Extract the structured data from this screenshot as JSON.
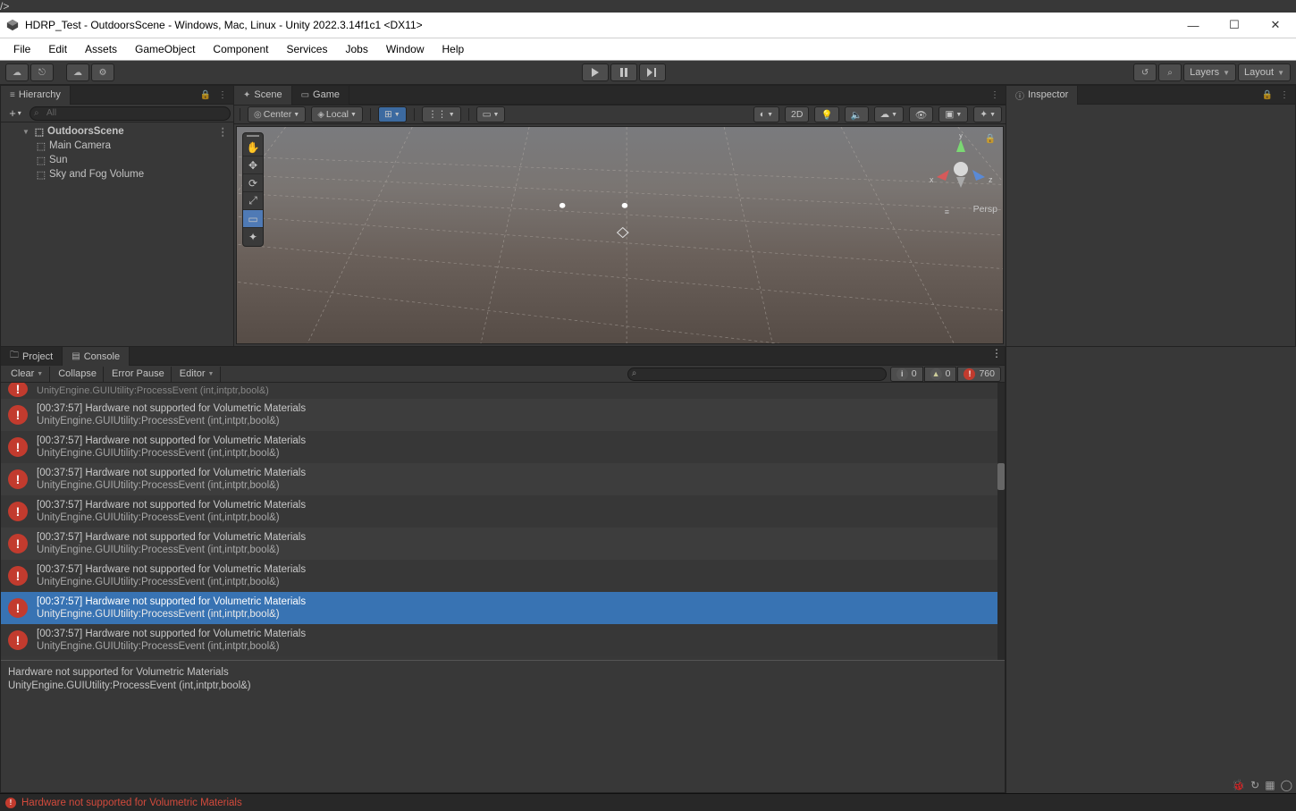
{
  "window": {
    "title": "HDRP_Test - OutdoorsScene - Windows, Mac, Linux - Unity 2022.3.14f1c1 <DX11>"
  },
  "menubar": [
    "File",
    "Edit",
    "Assets",
    "GameObject",
    "Component",
    "Services",
    "Jobs",
    "Window",
    "Help"
  ],
  "toolbar": {
    "layers_label": "Layers",
    "layout_label": "Layout"
  },
  "hierarchy": {
    "title": "Hierarchy",
    "search_placeholder": "All",
    "scene": "OutdoorsScene",
    "items": [
      "Main Camera",
      "Sun",
      "Sky and Fog Volume"
    ]
  },
  "scene_tabs": {
    "scene": "Scene",
    "game": "Game"
  },
  "scene_toolbar": {
    "pivot": "Center",
    "space": "Local",
    "mode2d": "2D",
    "persp": "Persp"
  },
  "inspector": {
    "title": "Inspector"
  },
  "bottom_tabs": {
    "project": "Project",
    "console": "Console"
  },
  "console_toolbar": {
    "clear": "Clear",
    "collapse": "Collapse",
    "error_pause": "Error Pause",
    "editor": "Editor",
    "info_count": "0",
    "warn_count": "0",
    "err_count": "760"
  },
  "console_msg": {
    "line1": "[00:37:57] Hardware not supported for Volumetric Materials",
    "line2": "UnityEngine.GUIUtility:ProcessEvent (int,intptr,bool&)"
  },
  "detail": {
    "line1": "Hardware not supported for Volumetric Materials",
    "line2": "UnityEngine.GUIUtility:ProcessEvent (int,intptr,bool&)"
  },
  "statusbar": {
    "text": "Hardware not supported for Volumetric Materials"
  },
  "gizmo": {
    "x": "x",
    "y": "y",
    "z": "z"
  }
}
